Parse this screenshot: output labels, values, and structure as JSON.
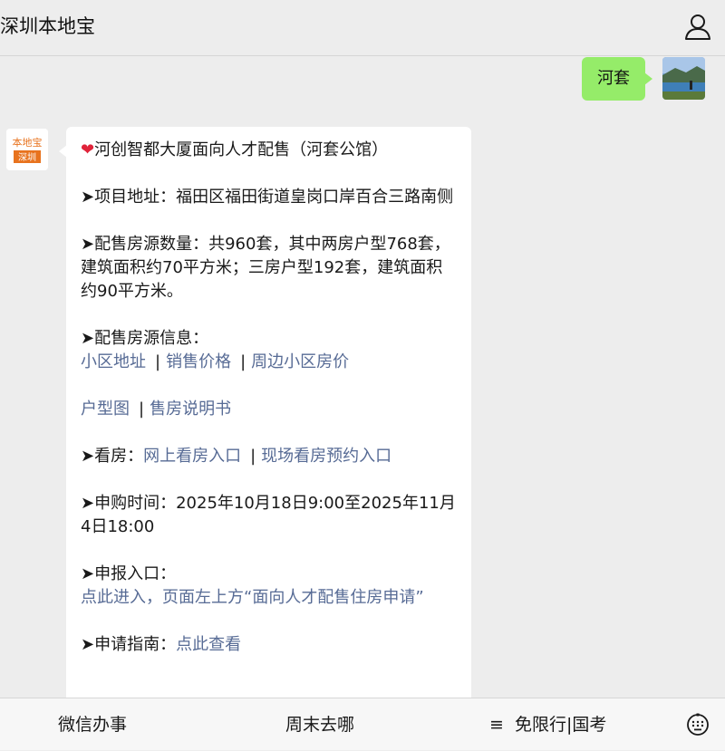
{
  "header": {
    "title": "深圳本地宝"
  },
  "outgoing": {
    "text": "河套"
  },
  "avatar_logo": {
    "top": "本地宝",
    "bottom": "深圳"
  },
  "message": {
    "title": "河创智都大厦面向人才配售（河套公馆）",
    "address_label": "➤项目地址：",
    "address_text": "福田区福田街道皇岗口岸百合三路南侧",
    "count_label": "➤配售房源数量：",
    "count_text": "共960套，其中两房户型768套，建筑面积约70平方米；三房户型192套，建筑面积约90平方米。",
    "info_label": "➤配售房源信息：",
    "info_links": [
      "小区地址",
      "销售价格",
      "周边小区房价"
    ],
    "info_links2": [
      "户型图",
      "售房说明书"
    ],
    "view_label": "➤看房：",
    "view_links": [
      "网上看房入口",
      "现场看房预约入口"
    ],
    "time_label": "➤申购时间：",
    "time_text": "2025年10月18日9:00至2025年11月4日18:00",
    "apply_label": "➤申报入口：",
    "apply_link": "点此进入，页面左上方“面向人才配售住房申请”",
    "guide_label": "➤申请指南：",
    "guide_link": "点此查看"
  },
  "bottom_menu": {
    "item1": "微信办事",
    "item2": "周末去哪",
    "item3_icon": "≡",
    "item3": "免限行|国考"
  },
  "colors": {
    "link": "#576b95",
    "bubble_out": "#95ec69",
    "bg": "#ededed"
  }
}
